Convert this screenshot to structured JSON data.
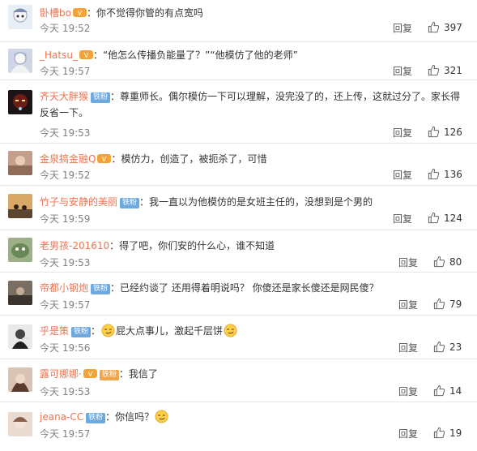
{
  "comments": [
    {
      "nick": "卧槽bo",
      "badge": "",
      "vip": true,
      "text": "你不觉得你管的有点宽吗",
      "time": "今天 19:52",
      "reply": "回复",
      "likes": "397",
      "avatar_color": "#dfe6ef"
    },
    {
      "nick": "_Hatsu_",
      "badge": "",
      "vip": true,
      "text": "“他怎么传播负能量了？”“他模仿了他的老师”",
      "time": "今天 19:57",
      "reply": "回复",
      "likes": "321",
      "avatar_color": "#c9d3e6"
    },
    {
      "nick": "齐天大胖猴",
      "badge": "铁粉",
      "vip": false,
      "text": "尊重师长。偶尔模仿一下可以理解，没完没了的，还上传，这就过分了。家长得反省一下。",
      "time": "今天 19:53",
      "reply": "回复",
      "likes": "126",
      "avatar_color": "#3a2624"
    },
    {
      "nick": "金泉搞金融Q",
      "badge": "",
      "vip": true,
      "text": "模仿力，创造了，被扼杀了，可惜",
      "time": "今天 19:52",
      "reply": "回复",
      "likes": "136",
      "avatar_color": "#c8a996"
    },
    {
      "nick": "竹子与安静的美丽",
      "badge": "铁粉",
      "vip": false,
      "text": "我一直以为他模仿的是女班主任的，没想到是个男的",
      "time": "今天 19:59",
      "reply": "回复",
      "likes": "124",
      "avatar_color": "#8d6a4f"
    },
    {
      "nick": "老男孩-201610",
      "badge": "",
      "vip": false,
      "text": "得了吧，你们安的什么心，谁不知道",
      "time": "今天 19:53",
      "reply": "回复",
      "likes": "80",
      "avatar_color": "#6f8a62"
    },
    {
      "nick": "帝都小钢炮",
      "badge": "铁粉",
      "vip": false,
      "text": "已经约谈了 还用得着明说吗？ 你傻还是家长傻还是网民傻？",
      "time": "今天 19:57",
      "reply": "回复",
      "likes": "79",
      "avatar_color": "#5a5046"
    },
    {
      "nick": "乎是策",
      "badge": "铁粉",
      "vip": false,
      "text_before": "",
      "text": "屁大点事儿，激起千层饼",
      "emoji_before": true,
      "emoji_after": true,
      "time": "今天 19:56",
      "reply": "回复",
      "likes": "23",
      "avatar_color": "#2f2f2f"
    },
    {
      "nick": "露可娜娜·",
      "badge": "铁粉",
      "badge_gold": true,
      "vip": true,
      "text": "我信了",
      "time": "今天 19:53",
      "reply": "回复",
      "likes": "14",
      "avatar_color": "#b58b78"
    },
    {
      "nick": "jeana-CC",
      "badge": "铁粉",
      "vip": false,
      "text": "你信吗？",
      "emoji_after": true,
      "time": "今天 19:57",
      "reply": "回复",
      "likes": "19",
      "avatar_color": "#d7b7a6"
    }
  ],
  "icons": {
    "like": "thumbs-up-icon",
    "vip": "vip-crown-icon",
    "emoji": "smirk-emoji-icon"
  },
  "colors": {
    "nick": "#eb7350",
    "time": "#808080",
    "badge": "#6fa8dc"
  }
}
